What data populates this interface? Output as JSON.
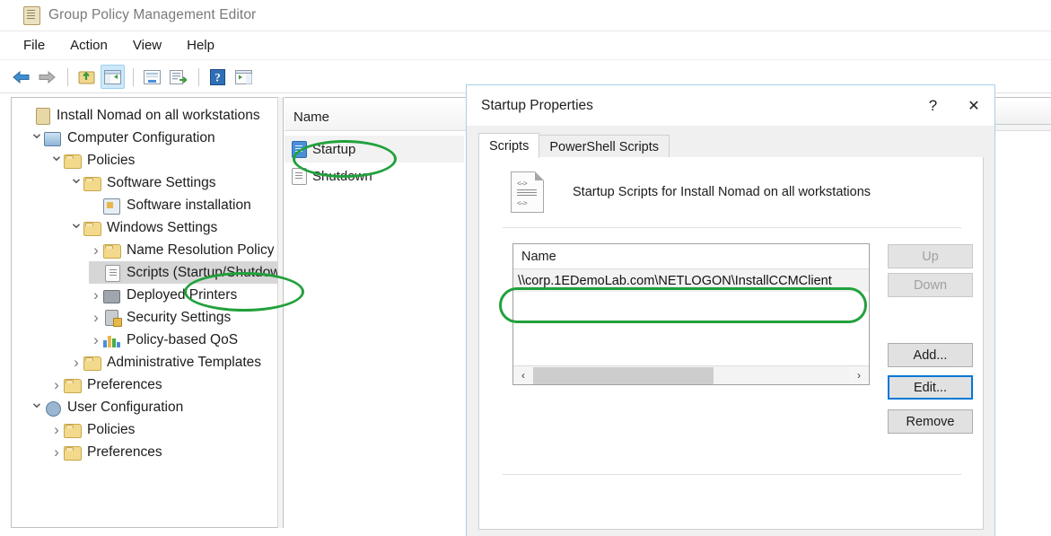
{
  "window": {
    "title": "Group Policy Management Editor",
    "title_icon": "policy-scroll-icon",
    "menus": [
      "File",
      "Action",
      "View",
      "Help"
    ],
    "toolbar": [
      {
        "name": "back-icon",
        "label": "Back"
      },
      {
        "name": "forward-icon",
        "label": "Forward"
      },
      {
        "name": "up-one-level-icon",
        "label": "Up One Level"
      },
      {
        "name": "show-hide-console-tree-icon",
        "label": "Show/Hide Console Tree",
        "selected": true
      },
      {
        "name": "properties-icon",
        "label": "Properties"
      },
      {
        "name": "export-list-icon",
        "label": "Export List"
      },
      {
        "name": "help-icon",
        "label": "Help"
      },
      {
        "name": "show-hide-action-pane-icon",
        "label": "Show/Hide Action Pane"
      }
    ]
  },
  "tree": {
    "items": [
      {
        "label": "Install Nomad on all workstations",
        "indent": 0,
        "chev": "none",
        "icon": "policy-scroll-icon",
        "selected": false
      },
      {
        "label": "Computer Configuration",
        "indent": 1,
        "chev": "down",
        "icon": "computer-icon",
        "selected": false
      },
      {
        "label": "Policies",
        "indent": 2,
        "chev": "down",
        "icon": "folder-icon",
        "selected": false
      },
      {
        "label": "Software Settings",
        "indent": 3,
        "chev": "down",
        "icon": "folder-icon",
        "selected": false
      },
      {
        "label": "Software installation",
        "indent": 4,
        "chev": "none",
        "icon": "software-installation-icon",
        "selected": false
      },
      {
        "label": "Windows Settings",
        "indent": 3,
        "chev": "down",
        "icon": "folder-icon",
        "selected": false
      },
      {
        "label": "Name Resolution Policy",
        "indent": 4,
        "chev": "right",
        "icon": "folder-icon",
        "selected": false
      },
      {
        "label": "Scripts (Startup/Shutdown)",
        "indent": 4,
        "chev": "none",
        "icon": "scripts-icon",
        "selected": true
      },
      {
        "label": "Deployed Printers",
        "indent": 4,
        "chev": "right",
        "icon": "printer-icon",
        "selected": false
      },
      {
        "label": "Security Settings",
        "indent": 4,
        "chev": "right",
        "icon": "security-lock-icon",
        "selected": false
      },
      {
        "label": "Policy-based QoS",
        "indent": 4,
        "chev": "right",
        "icon": "bar-chart-icon",
        "selected": false
      },
      {
        "label": "Administrative Templates",
        "indent": 3,
        "chev": "right",
        "icon": "folder-icon",
        "selected": false
      },
      {
        "label": "Preferences",
        "indent": 2,
        "chev": "right",
        "icon": "folder-icon",
        "selected": false
      },
      {
        "label": "User Configuration",
        "indent": 1,
        "chev": "down",
        "icon": "user-icon",
        "selected": false
      },
      {
        "label": "Policies",
        "indent": 2,
        "chev": "right",
        "icon": "folder-icon",
        "selected": false
      },
      {
        "label": "Preferences",
        "indent": 2,
        "chev": "right",
        "icon": "folder-icon",
        "selected": false
      }
    ]
  },
  "list_pane": {
    "column_header": "Name",
    "rows": [
      {
        "label": "Startup",
        "icon": "startup-script-icon",
        "selected": true
      },
      {
        "label": "Shutdown",
        "icon": "shutdown-script-icon",
        "selected": false
      }
    ]
  },
  "dialog": {
    "title": "Startup Properties",
    "help_glyph": "?",
    "close_glyph": "✕",
    "tabs": [
      {
        "label": "Scripts",
        "active": true
      },
      {
        "label": "PowerShell Scripts",
        "active": false
      }
    ],
    "header_text": "Startup Scripts for Install Nomad on all workstations",
    "header_icon": "script-document-icon",
    "listbox": {
      "column_header": "Name",
      "items": [
        "\\\\corp.1EDemoLab.com\\NETLOGON\\InstallCCMClient"
      ],
      "scroll_left_glyph": "‹",
      "scroll_right_glyph": "›"
    },
    "buttons": [
      {
        "label": "Up",
        "state": "disabled"
      },
      {
        "label": "Down",
        "state": "disabled"
      },
      {
        "label": "Add...",
        "state": "normal"
      },
      {
        "label": "Edit...",
        "state": "focused"
      },
      {
        "label": "Remove",
        "state": "normal"
      }
    ]
  },
  "annotations": {
    "color": "#21a13c",
    "highlights": [
      "tree-scripts-startup-shutdown",
      "list-startup-row",
      "listbox-script-path"
    ]
  }
}
